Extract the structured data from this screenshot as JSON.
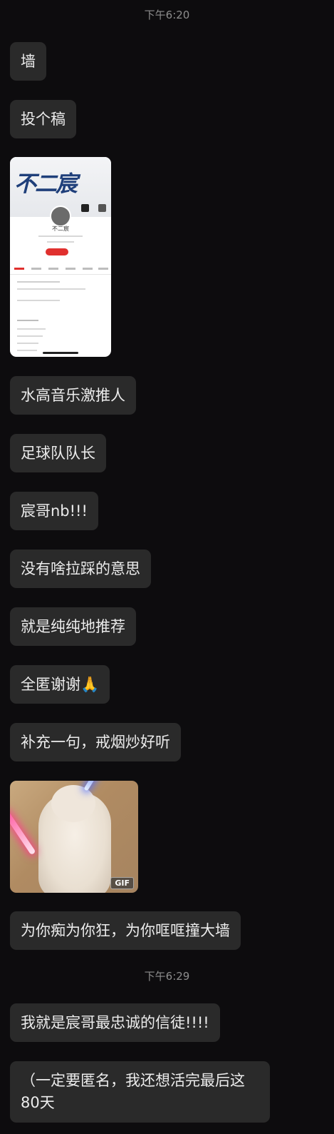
{
  "timestamps": [
    "下午6:20",
    "下午6:29"
  ],
  "messages": [
    "墙",
    "投个稿",
    "水高音乐激推人",
    "足球队队长",
    "宸哥nb!!!",
    "没有啥拉踩的意思",
    "就是纯纯地推荐",
    "全匿谢谢🙏",
    "补充一句，戒烟炒好听",
    "为你痴为你狂，为你哐哐撞大墙",
    "我就是宸哥最忠诚的信徒!!!!",
    "（一定要匿名，我还想活完最后这80天"
  ],
  "screenshot": {
    "logo": "不二宸",
    "name": "不二宸"
  },
  "gif_badge": "GIF"
}
